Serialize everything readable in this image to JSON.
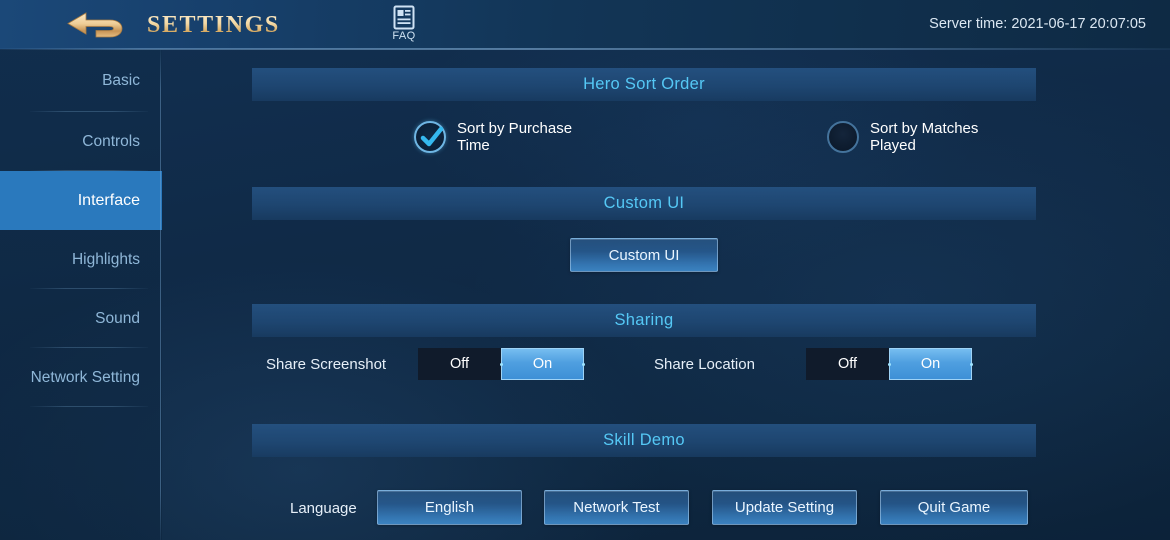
{
  "header": {
    "title": "SETTINGS",
    "back_icon": "back-arrow-icon",
    "faq_icon": "faq-document-icon",
    "faq_label": "FAQ",
    "server_time": "Server time: 2021-06-17 20:07:05"
  },
  "sidebar": {
    "items": [
      {
        "label": "Basic",
        "active": false
      },
      {
        "label": "Controls",
        "active": false
      },
      {
        "label": "Interface",
        "active": true
      },
      {
        "label": "Highlights",
        "active": false
      },
      {
        "label": "Sound",
        "active": false
      },
      {
        "label": "Network Setting",
        "active": false
      }
    ]
  },
  "sections": {
    "hero_sort_order": {
      "title": "Hero Sort Order",
      "options": [
        {
          "label": "Sort by Purchase Time",
          "selected": true
        },
        {
          "label": "Sort by Matches Played",
          "selected": false
        }
      ]
    },
    "custom_ui": {
      "title": "Custom UI",
      "button_label": "Custom UI"
    },
    "sharing": {
      "title": "Sharing",
      "toggles": [
        {
          "label": "Share Screenshot",
          "off_label": "Off",
          "on_label": "On",
          "value": "On"
        },
        {
          "label": "Share Location",
          "off_label": "Off",
          "on_label": "On",
          "value": "On"
        }
      ]
    },
    "skill_demo": {
      "title": "Skill Demo",
      "language_label": "Language",
      "language_value": "English",
      "buttons": [
        {
          "label": "Network Test"
        },
        {
          "label": "Update Setting"
        },
        {
          "label": "Quit Game"
        }
      ]
    }
  },
  "colors": {
    "accent_cyan": "#55c8f5",
    "title_gold": "#f0d49c",
    "active_nav_blue": "#2a79bd",
    "toggle_on_blue": "#4f9fe0",
    "panel_bg": "#102a47"
  }
}
